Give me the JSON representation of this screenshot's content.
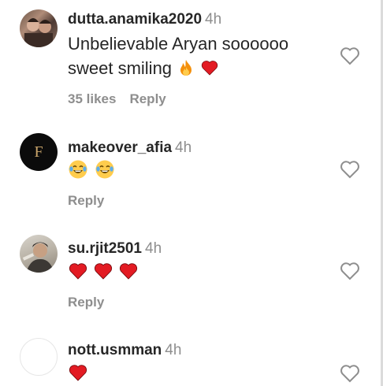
{
  "comments": [
    {
      "username": "dutta.anamika2020",
      "time": "4h",
      "text": "Unbelievable Aryan soooooo sweet smiling",
      "emojis": [
        "fire-emoji",
        "red-heart-emoji"
      ],
      "likes": "35 likes",
      "reply": "Reply"
    },
    {
      "username": "makeover_afia",
      "time": "4h",
      "emojis": [
        "tears-of-joy-emoji",
        "tears-of-joy-emoji"
      ],
      "reply": "Reply",
      "avatar_letter": "F"
    },
    {
      "username": "su.rjit2501",
      "time": "4h",
      "emojis": [
        "red-heart-emoji",
        "red-heart-emoji",
        "red-heart-emoji"
      ],
      "reply": "Reply"
    },
    {
      "username": "nott.usmman",
      "time": "4h",
      "emojis": [
        "red-heart-emoji"
      ]
    }
  ],
  "colors": {
    "text": "#262626",
    "secondary": "#8e8e8e",
    "heart": "#e31b23"
  },
  "icons": {
    "like": "heart-outline-icon"
  }
}
